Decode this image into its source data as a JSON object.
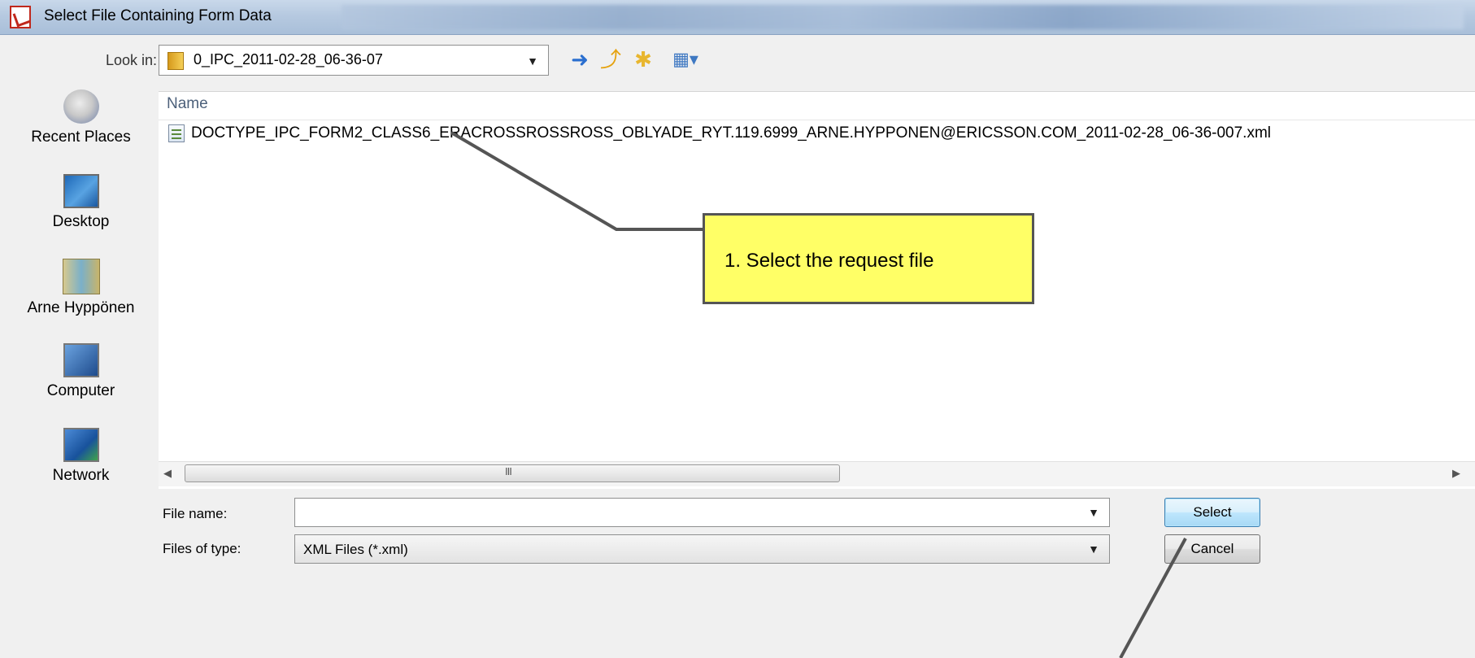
{
  "window": {
    "title": "Select File Containing Form Data"
  },
  "look_in": {
    "label": "Look in:",
    "value": "0_IPC_2011-02-28_06-36-07"
  },
  "toolbar": {
    "icons": [
      "back-icon",
      "up-folder-icon",
      "new-folder-icon",
      "views-menu-icon"
    ]
  },
  "places": [
    {
      "label": "Recent Places",
      "icon": "recent-places-icon"
    },
    {
      "label": "Desktop",
      "icon": "desktop-icon"
    },
    {
      "label": "Arne Hyppönen",
      "icon": "user-folder-icon"
    },
    {
      "label": "Computer",
      "icon": "computer-icon"
    },
    {
      "label": "Network",
      "icon": "network-icon"
    }
  ],
  "file_list": {
    "column": "Name",
    "files": [
      {
        "name": "DOCTYPE_IPC_FORM2_CLASS6_ERACROSSROSSROSS_OBLYADE_RYT.119.6999_ARNE.HYPPONEN@ERICSSON.COM_2011-02-28_06-36-007.xml",
        "icon": "xml-file-icon"
      }
    ]
  },
  "scrollbar": {
    "grip": "III"
  },
  "file_name": {
    "label": "File name:",
    "value": ""
  },
  "file_type": {
    "label": "Files of type:",
    "value": "XML Files (*.xml)"
  },
  "buttons": {
    "select": "Select",
    "cancel": "Cancel"
  },
  "annotation": {
    "text": "1. Select the request file",
    "color": "#ffff66"
  }
}
